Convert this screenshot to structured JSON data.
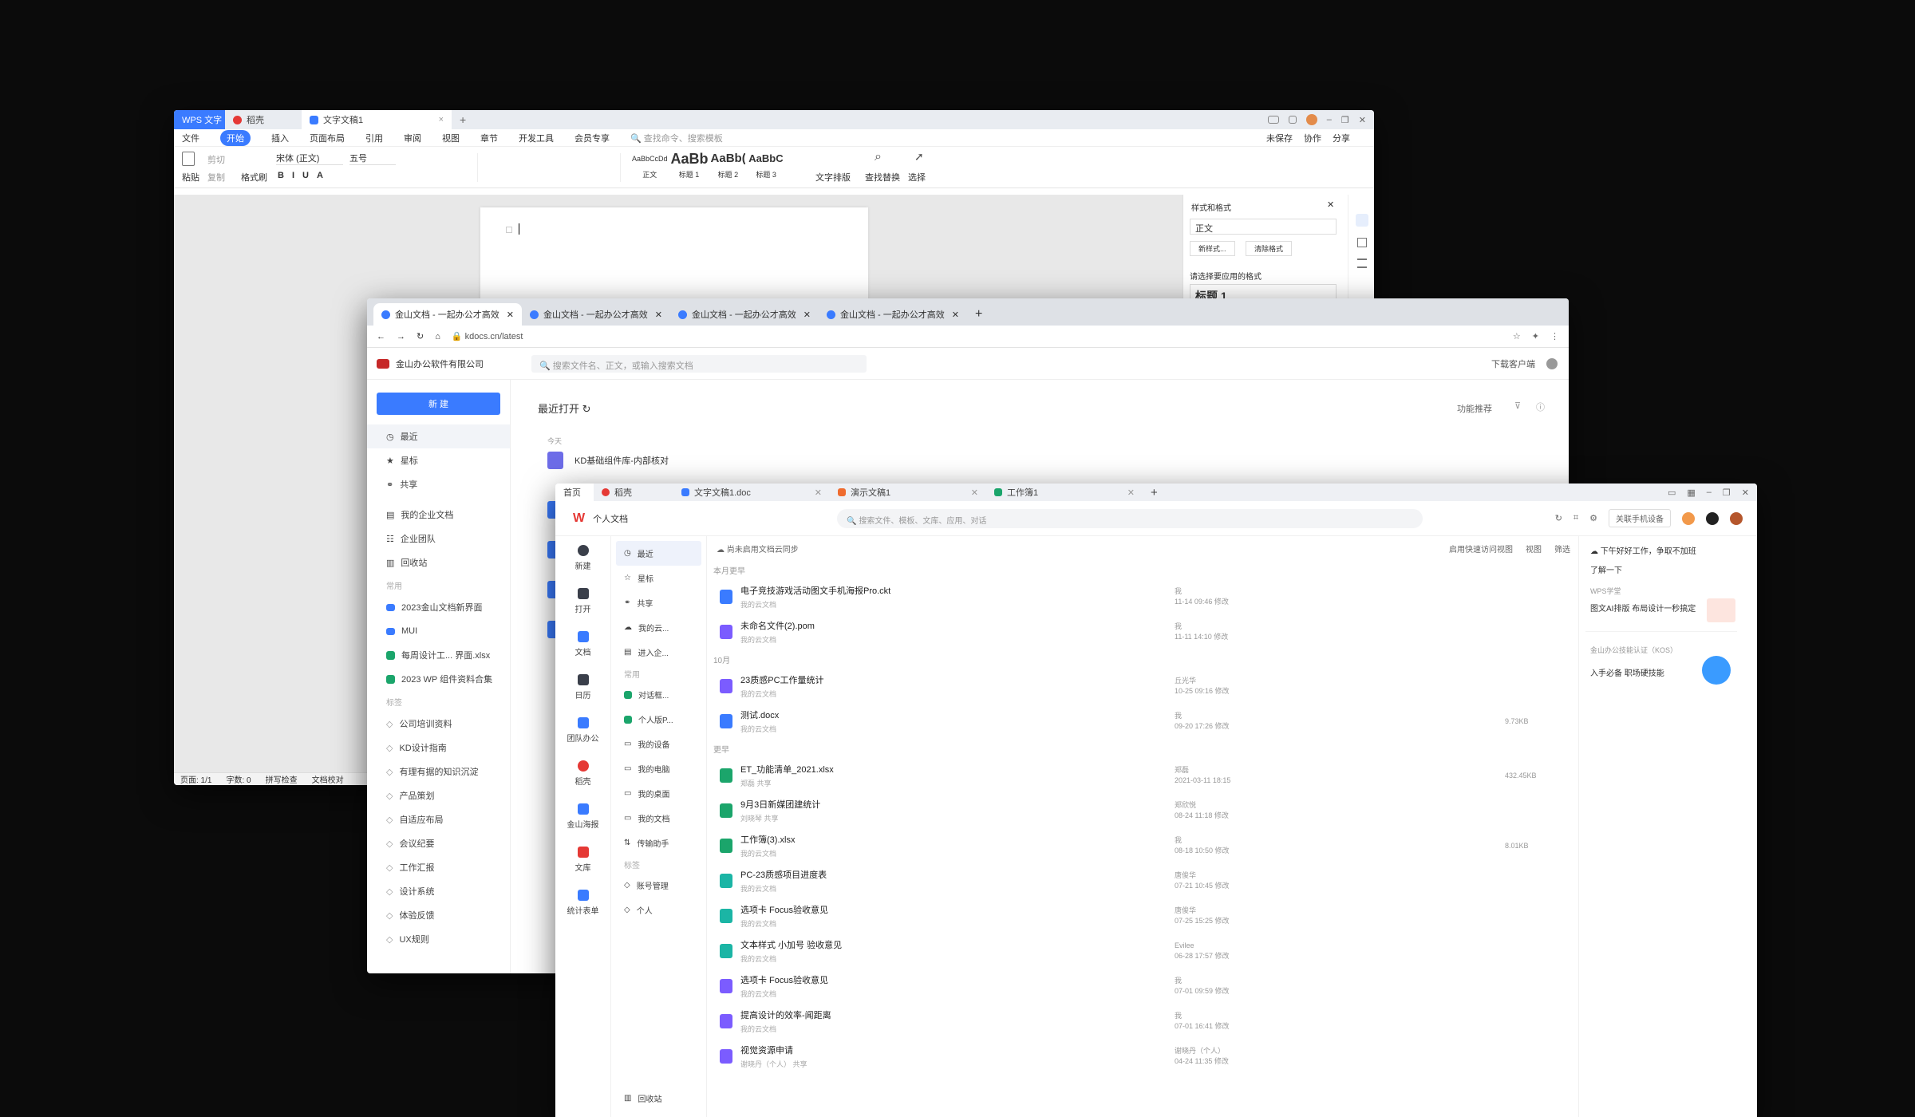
{
  "writer": {
    "tabs": [
      {
        "label": "WPS 文字"
      },
      {
        "label": "稻壳"
      },
      {
        "label": "文字文稿1"
      }
    ],
    "menu": [
      "文件",
      "开始",
      "插入",
      "页面布局",
      "引用",
      "审阅",
      "视图",
      "章节",
      "开发工具",
      "会员专享"
    ],
    "search_placeholder": "查找命令、搜索模板",
    "right_actions": [
      "未保存",
      "协作",
      "分享"
    ],
    "ribbon": {
      "paste": "粘贴",
      "cut": "剪切",
      "copy": "复制",
      "format_painter": "格式刷",
      "font": "宋体 (正文)",
      "size": "五号",
      "styles": [
        {
          "preview": "AaBbCcDd",
          "label": "正文"
        },
        {
          "preview": "AaBb",
          "label": "标题 1"
        },
        {
          "preview": "AaBb(",
          "label": "标题 2"
        },
        {
          "preview": "AaBbC(",
          "label": "标题 3"
        }
      ],
      "text_layout": "文字排版",
      "find_replace": "查找替换",
      "select": "选择"
    },
    "side_panel": {
      "title": "样式和格式",
      "current_style": "正文",
      "new_style": "新样式...",
      "clear_format": "清除格式",
      "apply_label": "请选择要应用的格式",
      "heading_preview": "标题 1"
    },
    "status": [
      "页面: 1/1",
      "字数: 0",
      "拼写检查",
      "文档校对"
    ]
  },
  "browser": {
    "tabs": [
      {
        "label": "金山文档 - 一起办公才高效"
      },
      {
        "label": "金山文档 - 一起办公才高效"
      },
      {
        "label": "金山文档 - 一起办公才高效"
      },
      {
        "label": "金山文档 - 一起办公才高效"
      }
    ],
    "url": "kdocs.cn/latest",
    "company": "金山办公软件有限公司",
    "search_placeholder": "搜索文件名、正文，或输入搜索文档",
    "download_client": "下载客户端",
    "new_button": "新 建",
    "nav": [
      {
        "label": "最近",
        "icon": "clock-icon"
      },
      {
        "label": "星标",
        "icon": "star-icon"
      },
      {
        "label": "共享",
        "icon": "share-icon"
      }
    ],
    "nav2": [
      {
        "label": "我的企业文档"
      },
      {
        "label": "企业团队"
      },
      {
        "label": "回收站"
      }
    ],
    "common_label": "常用",
    "common": [
      {
        "label": "2023金山文档新界面",
        "color": "#3a7bff"
      },
      {
        "label": "MUI",
        "color": "#3a7bff"
      },
      {
        "label": "每周设计工... 界面.xlsx",
        "color": "#1ba56b"
      },
      {
        "label": "2023 WP 组件资料合集",
        "color": "#1ba56b"
      }
    ],
    "tags_label": "标签",
    "tags": [
      "公司培训资料",
      "KD设计指南",
      "有理有据的知识沉淀",
      "产品策划",
      "自适应布局",
      "会议纪要",
      "工作汇报",
      "设计系统",
      "体验反馈",
      "UX规则"
    ],
    "main_title": "最近打开",
    "feature_rec": "功能推荐",
    "today": "今天",
    "first_file": "KD基础组件库-内部核对"
  },
  "home": {
    "tabs": [
      {
        "label": "首页"
      },
      {
        "label": "稻壳"
      },
      {
        "label": "文字文稿1.doc"
      },
      {
        "label": "演示文稿1"
      },
      {
        "label": "工作簿1"
      }
    ],
    "title": "个人文档",
    "search_placeholder": "搜索文件、模板、文库、应用、对话",
    "phone_device": "关联手机设备",
    "rail": [
      {
        "label": "新建",
        "color": "#3a3f4a"
      },
      {
        "label": "打开",
        "color": "#3a3f4a"
      },
      {
        "label": "文档",
        "color": "#3a7bff"
      },
      {
        "label": "日历",
        "color": "#3a3f4a"
      },
      {
        "label": "团队办公",
        "color": "#3a7bff"
      },
      {
        "label": "稻壳",
        "color": "#e53935"
      },
      {
        "label": "金山海报",
        "color": "#3a7bff"
      },
      {
        "label": "文库",
        "color": "#e53935"
      },
      {
        "label": "统计表单",
        "color": "#3a7bff"
      }
    ],
    "sub": [
      {
        "label": "最近"
      },
      {
        "label": "星标"
      },
      {
        "label": "共享"
      },
      {
        "label": "我的云..."
      },
      {
        "label": "进入企..."
      }
    ],
    "sub_common_label": "常用",
    "sub_common": [
      {
        "label": "对话框..."
      },
      {
        "label": "个人版P..."
      },
      {
        "label": "我的设备"
      },
      {
        "label": "我的电脑"
      },
      {
        "label": "我的桌面"
      },
      {
        "label": "我的文档"
      },
      {
        "label": "传输助手"
      }
    ],
    "sub_tags_label": "标签",
    "sub_tags": [
      {
        "label": "账号管理"
      },
      {
        "label": "个人"
      }
    ],
    "recycle": "回收站",
    "cloud_sync": "尚未启用文档云同步",
    "quick_access": "启用快速访问视图",
    "view": "视图",
    "filter": "筛选",
    "groups": [
      {
        "label": "本月更早",
        "files": [
          {
            "name": "电子竞技游戏活动图文手机海报Pro.ckt",
            "sub": "我的云文档",
            "owner": "我",
            "date": "11-14 09:46 修改",
            "size": "",
            "color": "#3a7bff"
          },
          {
            "name": "未命名文件(2).pom",
            "sub": "我的云文档",
            "owner": "我",
            "date": "11-11 14:10 修改",
            "size": "",
            "color": "#7b5cff"
          }
        ]
      },
      {
        "label": "10月",
        "files": [
          {
            "name": "23质感PC工作量统计",
            "sub": "我的云文档",
            "owner": "丘光华",
            "date": "10-25 09:16 修改",
            "size": "",
            "color": "#7b5cff"
          },
          {
            "name": "测试.docx",
            "sub": "我的云文档",
            "owner": "我",
            "date": "09-20 17:26 修改",
            "size": "9.73KB",
            "color": "#3a7bff"
          }
        ]
      },
      {
        "label": "更早",
        "files": [
          {
            "name": "ET_功能清单_2021.xlsx",
            "sub": "郑磊 共享",
            "owner": "郑磊",
            "date": "2021-03-11 18:15",
            "size": "432.45KB",
            "color": "#1ba56b"
          },
          {
            "name": "9月3日新媒团建统计",
            "sub": "刘晓琴 共享",
            "owner": "郑欣悦",
            "date": "08-24 11:18 修改",
            "size": "",
            "color": "#1ba56b"
          },
          {
            "name": "工作簿(3).xlsx",
            "sub": "我的云文档",
            "owner": "我",
            "date": "08-18 10:50 修改",
            "size": "8.01KB",
            "color": "#1ba56b"
          },
          {
            "name": "PC-23质感项目进度表",
            "sub": "我的云文档",
            "owner": "唐俊华",
            "date": "07-21 10:45 修改",
            "size": "",
            "color": "#1bb5a5"
          },
          {
            "name": "选项卡 Focus验收意见",
            "sub": "我的云文档",
            "owner": "唐俊华",
            "date": "07-25 15:25 修改",
            "size": "",
            "color": "#1bb5a5"
          },
          {
            "name": "文本样式 小加号 验收意见",
            "sub": "我的云文档",
            "owner": "Evilee",
            "date": "06-28 17:57 修改",
            "size": "",
            "color": "#1bb5a5"
          },
          {
            "name": "选项卡 Focus验收意见",
            "sub": "我的云文档",
            "owner": "我",
            "date": "07-01 09:59 修改",
            "size": "",
            "color": "#7b5cff"
          },
          {
            "name": "提高设计的效率-闻距离",
            "sub": "我的云文档",
            "owner": "我",
            "date": "07-01 16:41 修改",
            "size": "",
            "color": "#7b5cff"
          },
          {
            "name": "视觉资源申请",
            "sub": "谢晓丹（个人） 共享",
            "owner": "谢晓丹（个人）",
            "date": "04-24 11:35 修改",
            "size": "",
            "color": "#7b5cff"
          }
        ]
      }
    ],
    "right": {
      "greeting": "下午好好工作，争取不加班",
      "learn_more": "了解一下",
      "cards": [
        {
          "header": "WPS学堂",
          "body": "图文AI排版 布局设计一秒搞定"
        },
        {
          "header": "金山办公技能认证（KOS）",
          "body": "入手必备 职场硬技能"
        }
      ]
    }
  }
}
